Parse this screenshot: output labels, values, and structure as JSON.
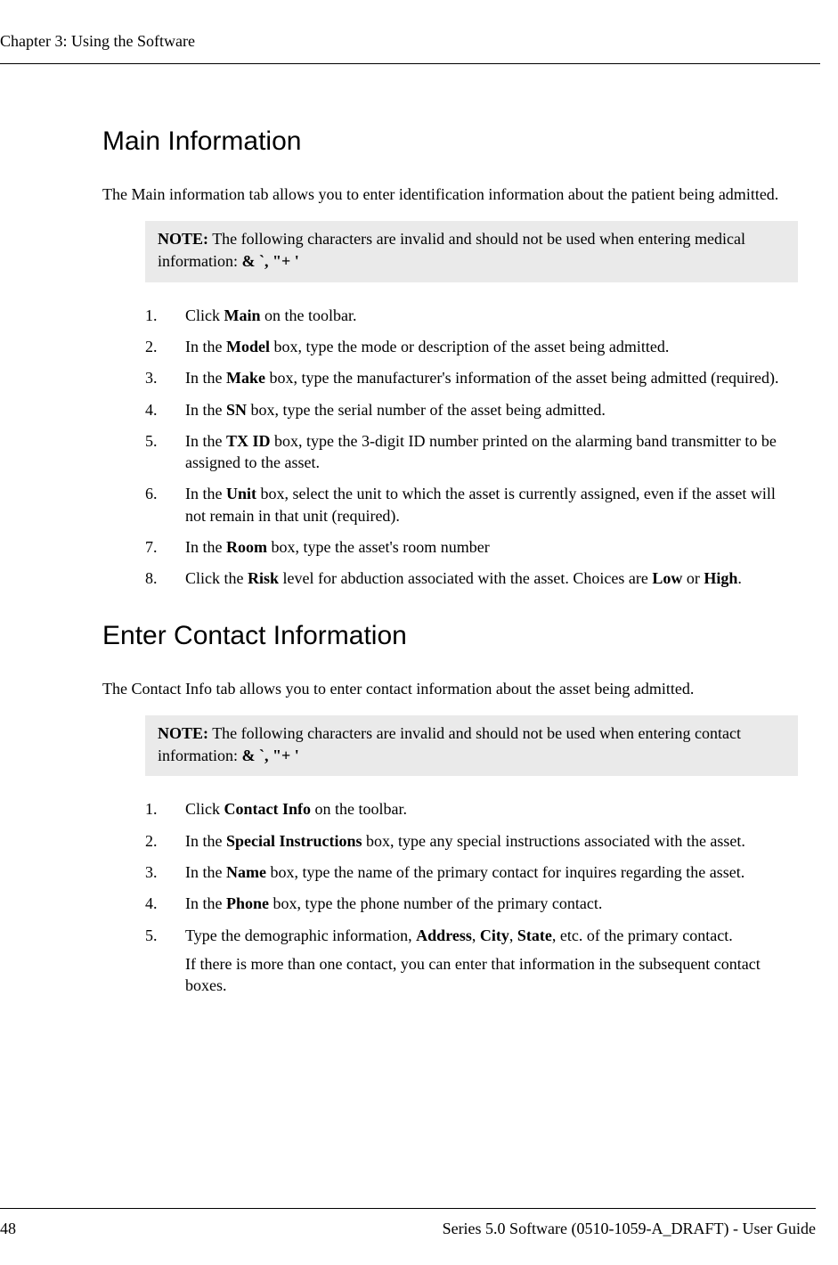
{
  "header": {
    "chapter": "Chapter 3: Using the Software"
  },
  "section1": {
    "title": "Main Information",
    "intro": "The Main information tab allows you to enter identification information about the patient being admitted.",
    "note_label": "NOTE:",
    "note_text": " The following characters are invalid and should not be used when entering medical information: ",
    "note_chars": "&   `,   \"+   '",
    "steps": {
      "s1_a": "Click ",
      "s1_b": "Main",
      "s1_c": " on the toolbar.",
      "s2_a": "In the ",
      "s2_b": "Model",
      "s2_c": " box, type the mode or description of the asset being admitted.",
      "s3_a": "In the ",
      "s3_b": "Make",
      "s3_c": " box, type the manufacturer's information of the asset being admitted (required).",
      "s4_a": "In the ",
      "s4_b": "SN",
      "s4_c": " box, type the serial number of the asset being admitted.",
      "s5_a": "In the ",
      "s5_b": "TX ID",
      "s5_c": " box, type the 3-digit ID number printed on the alarming band transmitter to be assigned to the asset.",
      "s6_a": "In the ",
      "s6_b": "Unit",
      "s6_c": " box, select the unit to which the asset is currently assigned, even if the asset will not remain in that unit (required).",
      "s7_a": "In the ",
      "s7_b": "Room",
      "s7_c": " box, type the asset's room number",
      "s8_a": "Click the ",
      "s8_b": "Risk",
      "s8_c": " level for abduction associated with the asset. Choices are ",
      "s8_d": "Low",
      "s8_e": " or ",
      "s8_f": "High",
      "s8_g": "."
    }
  },
  "section2": {
    "title": "Enter Contact Information",
    "intro": "The Contact Info tab allows you to enter contact information about the asset being admitted.",
    "note_label": "NOTE:",
    "note_text": " The following characters are invalid and should not be used when entering contact information: ",
    "note_chars": "&   `,   \"+   '",
    "steps": {
      "s1_a": "Click ",
      "s1_b": "Contact Info",
      "s1_c": " on the toolbar.",
      "s2_a": "In the ",
      "s2_b": "Special Instructions",
      "s2_c": " box, type any special instructions associated with the asset.",
      "s3_a": "In the ",
      "s3_b": "Name",
      "s3_c": " box, type the name of the primary contact for inquires regarding the asset.",
      "s4_a": "In the ",
      "s4_b": "Phone",
      "s4_c": " box, type the phone number of the primary contact.",
      "s5_a": "Type the demographic information, ",
      "s5_b": "Address",
      "s5_c": ", ",
      "s5_d": "City",
      "s5_e": ", ",
      "s5_f": "State",
      "s5_g": ", etc. of the primary contact.",
      "s5_sub": "If there is more than one contact, you can enter that information in the subsequent contact boxes."
    }
  },
  "footer": {
    "page": "48",
    "doc": "Series 5.0 Software (0510-1059-A_DRAFT) - User Guide"
  }
}
